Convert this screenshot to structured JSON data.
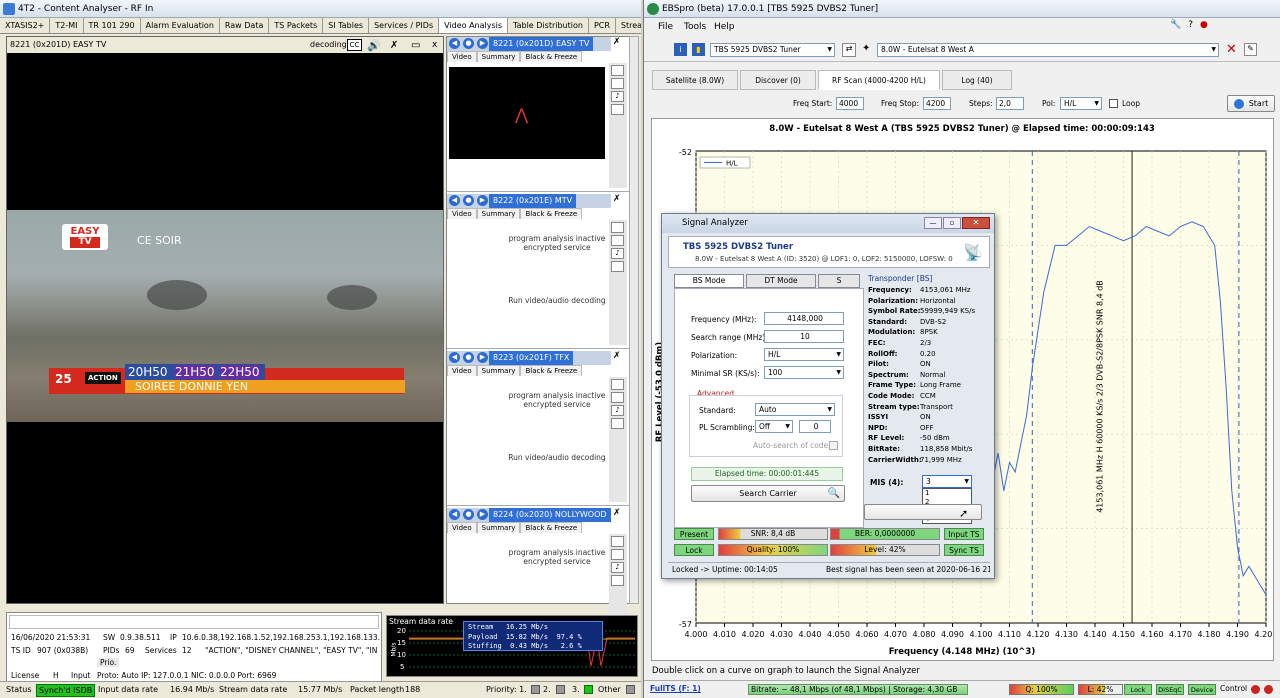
{
  "left_app": {
    "title": "4T2 - Content Analyser - RF In",
    "tabs": [
      "XTASIS2+",
      "T2-MI",
      "TR 101 290",
      "Alarm Evaluation",
      "Raw Data",
      "TS Packets",
      "SI Tables",
      "Services / PIDs",
      "Video Analysis",
      "Table Distribution",
      "PCR",
      "Stream"
    ],
    "active_tab": "Video Analysis",
    "main_video": {
      "title": "8221 (0x201D) EASY TV",
      "decoding_label": "decoding",
      "overlay_logo_top": "EASY",
      "overlay_logo_bottom": "TV",
      "overlay_tonight": "CE SOIR",
      "overlay_number": "25",
      "overlay_action": "ACTION",
      "overlay_time1": "20H50",
      "overlay_time2": "21H50",
      "overlay_time3": "22H50",
      "overlay_soiree": "SOIREE DONNIE YEN"
    },
    "channels": [
      {
        "label": "8221 (0x201D) EASY TV",
        "tabs": [
          "Video",
          "Summary",
          "Black & Freeze"
        ]
      },
      {
        "label": "8222 (0x201E) MTV",
        "tabs": [
          "Video",
          "Summary",
          "Black & Freeze"
        ],
        "status": "program analysis inactive\nencrypted service",
        "run_label": "Run video/audio decoding"
      },
      {
        "label": "8223 (0x201F) TFX",
        "tabs": [
          "Video",
          "Summary",
          "Black & Freeze"
        ],
        "status": "program analysis inactive\nencrypted service",
        "run_label": "Run video/audio decoding"
      },
      {
        "label": "8224 (0x2020) NOLLYWOOD",
        "tabs": [
          "Video",
          "Summary",
          "Black & Freeze"
        ],
        "status": "program analysis inactive\nencrypted service"
      }
    ],
    "info": {
      "datetime": "16/06/2020 21:53:31",
      "sw_label": "SW",
      "sw_value": "0.9.38.511",
      "ip_label": "IP",
      "ip_value": "10.6.0.38,192.168.1.52,192.168.253.1,192.168.133.",
      "tsid_label": "TS ID",
      "tsid_value": "907 (0x038B)",
      "pids_label": "PIDs",
      "pids_value": "69",
      "services_label": "Services",
      "services_value": "12",
      "services_list": "\"ACTION\", \"DISNEY CHANNEL\", \"EASY TV\", \"IN",
      "prio_label": "Prio.",
      "license_label": "License",
      "license_value": "H",
      "input_label": "Input",
      "input_value": "Proto: Auto IP: 127.0.0.1 NIC: 0.0.0.0 Port: 6969"
    },
    "stream_chart": {
      "title": "Stream data rate",
      "stream_line": "Stream   16.25 Mb/s",
      "payload_line": "Payload  15.82 Mb/s  97.4 %",
      "stuffing_line": "Stuffing  0.43 Mb/s   2.6 %",
      "yticks": [
        "20",
        "15",
        "10",
        "5"
      ],
      "ylabel": "Mb/s"
    },
    "status": {
      "status_label": "Status",
      "sync_label": "Synch'd ISDB",
      "input_rate_label": "Input data rate",
      "input_rate_value": "16.94 Mb/s",
      "stream_rate_label": "Stream data rate",
      "stream_rate_value": "15.77 Mb/s",
      "packet_label": "Packet length",
      "packet_value": "188",
      "priority_label": "Priority: 1.",
      "p2": "2.",
      "p3": "3.",
      "other_label": "Other"
    }
  },
  "right_app": {
    "title": "EBSpro (beta) 17.0.0.1 [TBS 5925 DVBS2 Tuner]",
    "menu": [
      "File",
      "Tools",
      "Help"
    ],
    "tuner_select": "TBS 5925 DVBS2 Tuner",
    "satellite_select": "8.0W - Eutelsat 8 West A",
    "main_tabs": [
      "Satellite (8.0W)",
      "Discover (0)",
      "RF Scan (4000-4200 H/L)",
      "Log (40)"
    ],
    "active_main_tab": "RF Scan (4000-4200 H/L)",
    "scan": {
      "freq_start_label": "Freq Start:",
      "freq_start": "4000",
      "freq_stop_label": "Freq Stop:",
      "freq_stop": "4200",
      "steps_label": "Steps:",
      "steps": "2,0",
      "pol_label": "Pol:",
      "pol": "H/L",
      "loop_label": "Loop",
      "start_label": "Start"
    },
    "chart_title": "8.0W - Eutelsat 8 West A (TBS 5925 DVBS2 Tuner) @ Elapsed time: 00:00:09:143",
    "chart_footer": "Double click on a curve on graph to launch the Signal Analyzer",
    "status_bar": {
      "fullts": "FullTS (F: 1)",
      "bitrate": "Bitrate: ~ 48,1 Mbps (of 48,1 Mbps) | Storage: 4,30 GB",
      "q": "Q: 100%",
      "l": "L: 42%",
      "lock": "Lock",
      "diseqc": "DiSEqC",
      "device": "Device",
      "control": "Control"
    }
  },
  "chart_data": {
    "type": "line",
    "title": "8.0W - Eutelsat 8 West A (TBS 5925 DVBS2 Tuner) @ Elapsed time: 00:00:09:143",
    "xlabel": "Frequency (4.148 MHz) (10^3)",
    "ylabel": "RF Level (-53,0 dBm)",
    "xlim": [
      4.0,
      4.2
    ],
    "ylim": [
      -57,
      -52
    ],
    "x_ticks": [
      "4.000",
      "4.010",
      "4.020",
      "4.030",
      "4.040",
      "4.050",
      "4.060",
      "4.070",
      "4.080",
      "4.090",
      "4.100",
      "4.110",
      "4.120",
      "4.130",
      "4.140",
      "4.150",
      "4.160",
      "4.170",
      "4.180",
      "4.190",
      "4.200"
    ],
    "y_ticks_shown": [
      "-52",
      "-57"
    ],
    "legend": "H/L",
    "annotation": "4153,061 MHz H 60000 KS/s 2/3 DVB-S2/8PSK SNR 8,4 dB",
    "series": [
      {
        "name": "H/L",
        "x": [
          4.104,
          4.106,
          4.108,
          4.11,
          4.112,
          4.114,
          4.116,
          4.118,
          4.122,
          4.126,
          4.13,
          4.134,
          4.138,
          4.142,
          4.146,
          4.15,
          4.154,
          4.158,
          4.162,
          4.166,
          4.17,
          4.174,
          4.178,
          4.182,
          4.184,
          4.186,
          4.188,
          4.19,
          4.192,
          4.194,
          4.196,
          4.198,
          4.2
        ],
        "y": [
          -55.5,
          -55.2,
          -55.6,
          -55.3,
          -55.4,
          -55.1,
          -54.8,
          -54.3,
          -53.5,
          -53.0,
          -53.0,
          -52.9,
          -52.8,
          -52.85,
          -52.9,
          -52.95,
          -52.9,
          -52.8,
          -52.85,
          -52.9,
          -52.8,
          -52.75,
          -52.8,
          -53.0,
          -53.6,
          -54.5,
          -55.6,
          -56.2,
          -56.5,
          -56.4,
          -56.5,
          -56.6,
          -56.7
        ]
      }
    ]
  },
  "signal_analyzer": {
    "title": "Signal Analyzer",
    "device": "TBS 5925 DVBS2 Tuner",
    "subtitle": "8.0W - Eutelsat 8 West A (ID: 3520) @ LOF1: 0, LOF2: 5150000, LOFSW: 0",
    "tabs": [
      "BS Mode",
      "DT Mode",
      "S"
    ],
    "frequency_label": "Frequency (MHz):",
    "frequency": "4148,000",
    "search_range_label": "Search range (MHz):",
    "search_range": "10",
    "polarization_label": "Polarization:",
    "polarization": "H/L",
    "minsr_label": "Minimal SR (KS/s):",
    "minsr": "100",
    "advanced_label": "Advanced",
    "standard_label": "Standard:",
    "standard": "Auto",
    "pl_label": "PL Scrambling:",
    "pl": "Off",
    "pl_value": "0",
    "autosearch_label": "Auto-search of code",
    "elapsed": "Elapsed time: 00:00:01:445",
    "search_btn": "Search Carrier",
    "transponder_header": "Transponder [BS]",
    "transponder": [
      [
        "Frequency:",
        "4153,061 MHz"
      ],
      [
        "Polarization:",
        "Horizontal"
      ],
      [
        "Symbol Rate:",
        "59999,949 KS/s"
      ],
      [
        "Standard:",
        "DVB-S2"
      ],
      [
        "Modulation:",
        "8PSK"
      ],
      [
        "FEC:",
        "2/3"
      ],
      [
        "RollOff:",
        "0.20"
      ],
      [
        "Pilot:",
        "ON"
      ],
      [
        "Spectrum:",
        "Normal"
      ],
      [
        "Frame Type:",
        "Long Frame"
      ],
      [
        "Code Mode:",
        "CCM"
      ],
      [
        "Stream type:",
        "Transport"
      ],
      [
        "ISSYI",
        "ON"
      ],
      [
        "NPD:",
        "OFF"
      ],
      [
        "RF Level:",
        "-50 dBm"
      ],
      [
        "BitRate:",
        "118,858 Mbit/s"
      ],
      [
        "CarrierWidth:",
        "71,999 MHz"
      ]
    ],
    "mis_label": "MIS (4):",
    "mis_value": "3",
    "mis_options": [
      "1",
      "2",
      "3",
      "4"
    ],
    "present": "Present",
    "snr": "SNR: 8,4 dB",
    "ber": "BER: 0,0000000",
    "input_ts": "Input TS",
    "lock": "Lock",
    "quality": "Quality: 100%",
    "level": "Level: 42%",
    "sync_ts": "Sync TS",
    "uptime": "Locked -> Uptime: 00:14:05",
    "best": "Best signal has been seen at 2020-06-16 21:3"
  }
}
